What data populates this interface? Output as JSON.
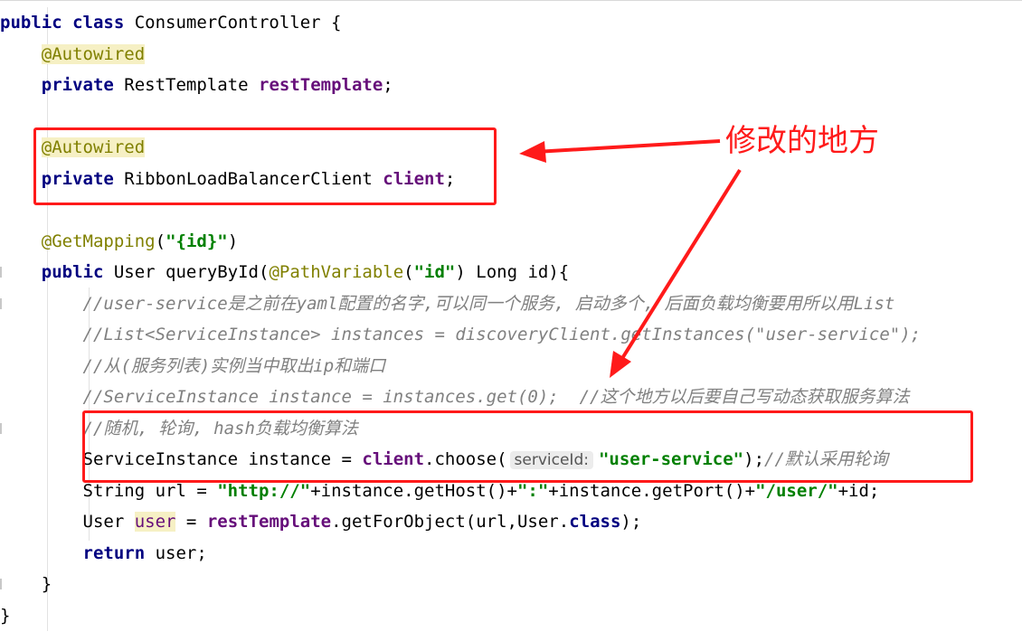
{
  "code": {
    "lines": [
      [
        {
          "t": "public class ",
          "c": "kw"
        },
        {
          "t": "ConsumerController {",
          "c": "pl"
        }
      ],
      [
        {
          "t": "    ",
          "c": "pl"
        },
        {
          "t": "@Autowired",
          "c": "ann-hl"
        }
      ],
      [
        {
          "t": "    ",
          "c": "pl"
        },
        {
          "t": "private ",
          "c": "kw"
        },
        {
          "t": "RestTemplate ",
          "c": "pl"
        },
        {
          "t": "restTemplate",
          "c": "fld"
        },
        {
          "t": ";",
          "c": "pl"
        }
      ],
      [],
      [
        {
          "t": "    ",
          "c": "pl"
        },
        {
          "t": "@Autowired",
          "c": "ann-hl"
        }
      ],
      [
        {
          "t": "    ",
          "c": "pl"
        },
        {
          "t": "private ",
          "c": "kw"
        },
        {
          "t": "RibbonLoadBalancerClient ",
          "c": "pl"
        },
        {
          "t": "client",
          "c": "fld"
        },
        {
          "t": ";",
          "c": "pl"
        }
      ],
      [],
      [
        {
          "t": "    ",
          "c": "pl"
        },
        {
          "t": "@GetMapping",
          "c": "ann"
        },
        {
          "t": "(",
          "c": "pl"
        },
        {
          "t": "\"{id}\"",
          "c": "str"
        },
        {
          "t": ")",
          "c": "pl"
        }
      ],
      [
        {
          "t": "    ",
          "c": "pl"
        },
        {
          "t": "public ",
          "c": "kw"
        },
        {
          "t": "User queryById(",
          "c": "pl"
        },
        {
          "t": "@PathVariable",
          "c": "ann"
        },
        {
          "t": "(",
          "c": "pl"
        },
        {
          "t": "\"id\"",
          "c": "str"
        },
        {
          "t": ") Long id){",
          "c": "pl"
        }
      ],
      [
        {
          "t": "        ",
          "c": "pl"
        },
        {
          "t": "//user-service是之前在yaml配置的名字,可以同一个服务, 启动多个, 后面负载均衡要用所以用List",
          "c": "cmt"
        }
      ],
      [
        {
          "t": "        ",
          "c": "pl"
        },
        {
          "t": "//List<ServiceInstance> instances = discoveryClient.getInstances(\"user-service\");",
          "c": "cmt"
        }
      ],
      [
        {
          "t": "        ",
          "c": "pl"
        },
        {
          "t": "//从(服务列表)实例当中取出ip和端口",
          "c": "cmt"
        }
      ],
      [
        {
          "t": "        ",
          "c": "pl"
        },
        {
          "t": "//ServiceInstance instance = instances.get(0);  //这个地方以后要自己写动态获取服务算法",
          "c": "cmt"
        }
      ],
      [
        {
          "t": "        ",
          "c": "pl"
        },
        {
          "t": "//随机, 轮询, hash负载均衡算法",
          "c": "cmt"
        }
      ],
      [
        {
          "t": "        ",
          "c": "pl"
        },
        {
          "t": "ServiceInstance instance = ",
          "c": "pl"
        },
        {
          "t": "client",
          "c": "fld"
        },
        {
          "t": ".choose(",
          "c": "pl"
        },
        {
          "t": "serviceId:",
          "c": "hint"
        },
        {
          "t": "\"user-service\"",
          "c": "str"
        },
        {
          "t": ");",
          "c": "pl"
        },
        {
          "t": "//默认采用轮询",
          "c": "cmt"
        }
      ],
      [
        {
          "t": "        ",
          "c": "pl"
        },
        {
          "t": "String url = ",
          "c": "pl"
        },
        {
          "t": "\"http://\"",
          "c": "str"
        },
        {
          "t": "+instance.getHost()+",
          "c": "pl"
        },
        {
          "t": "\":\"",
          "c": "str"
        },
        {
          "t": "+instance.getPort()+",
          "c": "pl"
        },
        {
          "t": "\"/user/\"",
          "c": "str"
        },
        {
          "t": "+id;",
          "c": "pl"
        }
      ],
      [
        {
          "t": "        ",
          "c": "pl"
        },
        {
          "t": "User ",
          "c": "pl"
        },
        {
          "t": "user",
          "c": "var-hl"
        },
        {
          "t": " = ",
          "c": "pl"
        },
        {
          "t": "restTemplate",
          "c": "fld"
        },
        {
          "t": ".getForObject(url,User.",
          "c": "pl"
        },
        {
          "t": "class",
          "c": "kw"
        },
        {
          "t": ");",
          "c": "pl"
        }
      ],
      [
        {
          "t": "        ",
          "c": "pl"
        },
        {
          "t": "return ",
          "c": "kw"
        },
        {
          "t": "user;",
          "c": "pl"
        }
      ],
      [
        {
          "t": "    }",
          "c": "pl"
        }
      ],
      [
        {
          "t": "}",
          "c": "pl"
        }
      ]
    ]
  },
  "annotation": {
    "note_text": "修改的地方",
    "color": "#ff1a1a"
  },
  "colors": {
    "keyword": "#000080",
    "annotation": "#808000",
    "field": "#660e7a",
    "string": "#008000",
    "comment": "#808080"
  }
}
